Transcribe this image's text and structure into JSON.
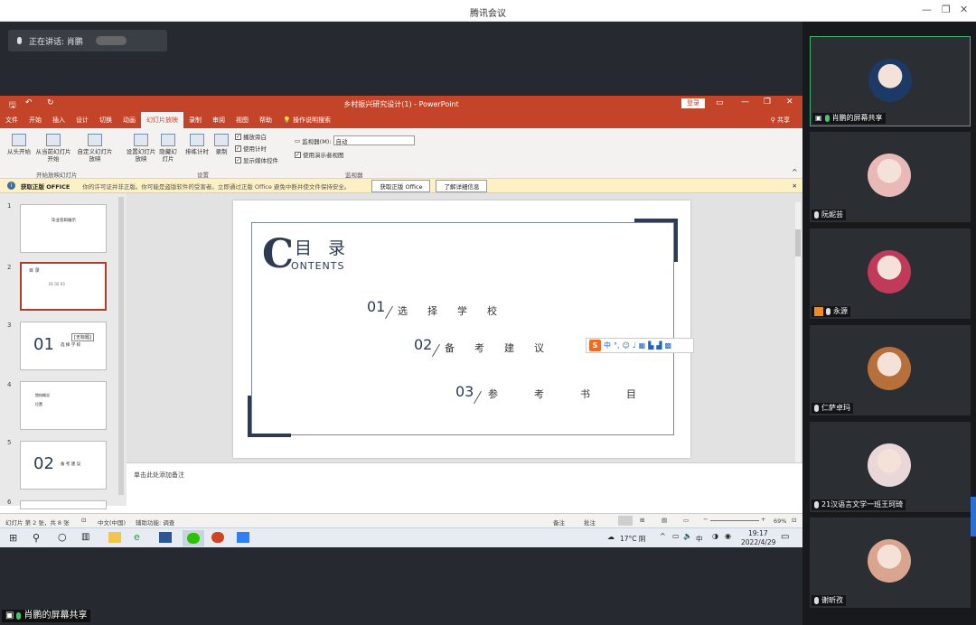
{
  "window": {
    "title": "腾讯会议"
  },
  "speaking": {
    "text": "正在讲话: 肖鹏"
  },
  "ppt": {
    "title": "乡村振兴研究设计(1) - PowerPoint",
    "login_button": "登录",
    "share": "共享",
    "tabs": [
      "文件",
      "开始",
      "插入",
      "设计",
      "切换",
      "动画",
      "幻灯片放映",
      "录制",
      "审阅",
      "视图",
      "帮助",
      "操作说明搜索"
    ],
    "active_tab": "幻灯片放映",
    "ribbon": {
      "from_start": "从头开始",
      "from_current": "从当前幻灯片开始",
      "custom": "自定义幻灯片放映",
      "group_start": "开始放映幻灯片",
      "setup": "设置幻灯片放映",
      "hide": "隐藏幻灯片",
      "rehearse": "排练计时",
      "record": "录制",
      "group_setup": "设置",
      "chk_narration": "播放旁白",
      "chk_timing": "使用计时",
      "chk_media": "显示媒体控件",
      "monitor_label": "监视器(M):",
      "monitor_value": "自动",
      "presenter_view": "使用演示者视图",
      "group_monitor": "监视器"
    },
    "warning": {
      "title": "获取正版 OFFICE",
      "text": "你的许可证并非正版。你可能是盗版软件的受害者。立即通过正版 Office 避免中断并使文件保持安全。",
      "btn_get": "获取正版 Office",
      "btn_more": "了解详细信息"
    },
    "thumbnails": [
      {
        "num": "1",
        "text": "毕业答辩展示",
        "sub": "·"
      },
      {
        "num": "2",
        "text": "目 录",
        "sub": "01 02 03"
      },
      {
        "num": "3",
        "text": "01",
        "sub": "选 择 学 校",
        "tooltip": "[无标题]"
      },
      {
        "num": "4",
        "text": "院校概况",
        "sub": "位置"
      },
      {
        "num": "5",
        "text": "02",
        "sub": "备 考 建 议"
      },
      {
        "num": "6",
        "text": "",
        "sub": ""
      }
    ],
    "slide": {
      "C": "C",
      "mulu": "目 录",
      "contents": "ONTENTS",
      "items": [
        {
          "num": "01",
          "label": "选择学校"
        },
        {
          "num": "02",
          "label": "备考建议"
        },
        {
          "num": "03",
          "label": "参考书目"
        }
      ]
    },
    "notes_placeholder": "单击此处添加备注",
    "status": {
      "slide_info": "幻灯片 第 2 张，共 8 张",
      "language": "中文(中国)",
      "accessibility": "辅助功能: 调查",
      "notes": "备注",
      "comments": "批注",
      "zoom": "69%"
    },
    "ime": {
      "text": "中"
    }
  },
  "taskbar": {
    "weather": "17°C 阴",
    "lang": "中",
    "time": "19:17",
    "date": "2022/4/29"
  },
  "participants": [
    {
      "name": "肖鹏的屏幕共享",
      "avatar_color": "#1d3a66",
      "active": true
    },
    {
      "name": "阮妮芸",
      "avatar_color": "#e8b9b7",
      "active": false
    },
    {
      "name": "永源",
      "avatar_color": "#c23a5a",
      "active": false
    },
    {
      "name": "仁萨卓玛",
      "avatar_color": "#b8703a",
      "active": false
    },
    {
      "name": "21汉语言文学一班王珂琦",
      "avatar_color": "#e9d7da",
      "active": false
    },
    {
      "name": "谢昕孜",
      "avatar_color": "#d9a58f",
      "active": false
    }
  ],
  "share_label": "肖鹏的屏幕共享"
}
